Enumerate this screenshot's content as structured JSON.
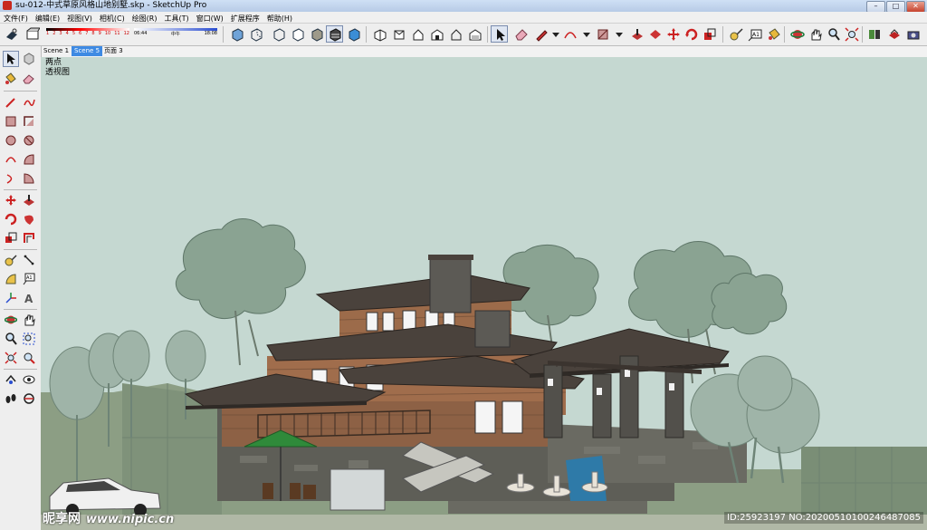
{
  "window": {
    "title": "su-012-中式草原风格山地别墅.skp - SketchUp Pro",
    "minimize": "–",
    "maximize": "□",
    "close": "✕"
  },
  "menu": [
    "文件(F)",
    "编辑(E)",
    "视图(V)",
    "相机(C)",
    "绘图(R)",
    "工具(T)",
    "窗口(W)",
    "扩展程序",
    "帮助(H)"
  ],
  "shadow_settings": {
    "months": [
      "1",
      "2",
      "3",
      "4",
      "5",
      "6",
      "7",
      "8",
      "9",
      "10",
      "11",
      "12"
    ],
    "time_start": "06:44",
    "time_mid": "中午",
    "time_end": "18:08"
  },
  "scene_tabs": [
    "Scene 1",
    "Scene 5",
    "页面 3"
  ],
  "active_tab": "Scene 5",
  "viewport": {
    "camera_line1": "两点",
    "camera_line2": "透视图",
    "sky_color": "#c5d8d1"
  },
  "watermark": {
    "logo_text": "昵享网",
    "url": "www.nipic.cn",
    "id_text": "ID:25923197 NO:20200510100246487085"
  },
  "icons": {
    "top": [
      "select-arrow-icon",
      "eraser-icon",
      "pencil-icon",
      "arc-icon",
      "rectangle-icon",
      "push-pull-icon",
      "move-icon",
      "rotate-icon",
      "scale-icon",
      "tape-measure-icon",
      "text-icon",
      "paint-bucket-icon",
      "orbit-icon",
      "pan-icon",
      "zoom-icon",
      "zoom-extents-icon",
      "components-icon",
      "materials-icon",
      "camera-icon"
    ],
    "views": [
      "iso-view-icon",
      "top-view-icon",
      "front-view-icon",
      "right-view-icon",
      "back-view-icon",
      "left-view-icon",
      "warehouse-icon",
      "house-icon",
      "house-outline-icon"
    ]
  },
  "colors": {
    "chrome": "#eeeeee",
    "tab_active": "#3e8ae3",
    "roof": "#4a423c",
    "wood": "#9c6b4a",
    "stone": "#5e5e57",
    "foliage": "#8aa392",
    "foliage_dark": "#6f8b7a",
    "ground": "#8c9e84"
  }
}
